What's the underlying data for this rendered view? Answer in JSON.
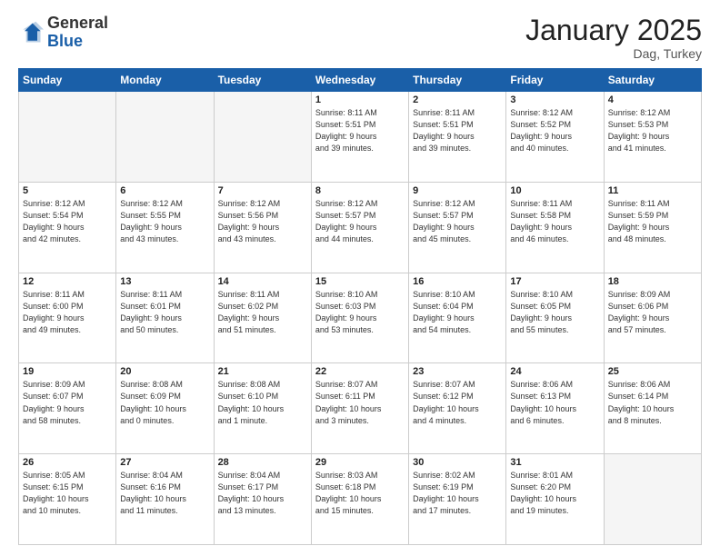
{
  "header": {
    "logo_general": "General",
    "logo_blue": "Blue",
    "month_title": "January 2025",
    "subtitle": "Dag, Turkey"
  },
  "weekdays": [
    "Sunday",
    "Monday",
    "Tuesday",
    "Wednesday",
    "Thursday",
    "Friday",
    "Saturday"
  ],
  "weeks": [
    [
      {
        "day": "",
        "info": ""
      },
      {
        "day": "",
        "info": ""
      },
      {
        "day": "",
        "info": ""
      },
      {
        "day": "1",
        "info": "Sunrise: 8:11 AM\nSunset: 5:51 PM\nDaylight: 9 hours\nand 39 minutes."
      },
      {
        "day": "2",
        "info": "Sunrise: 8:11 AM\nSunset: 5:51 PM\nDaylight: 9 hours\nand 39 minutes."
      },
      {
        "day": "3",
        "info": "Sunrise: 8:12 AM\nSunset: 5:52 PM\nDaylight: 9 hours\nand 40 minutes."
      },
      {
        "day": "4",
        "info": "Sunrise: 8:12 AM\nSunset: 5:53 PM\nDaylight: 9 hours\nand 41 minutes."
      }
    ],
    [
      {
        "day": "5",
        "info": "Sunrise: 8:12 AM\nSunset: 5:54 PM\nDaylight: 9 hours\nand 42 minutes."
      },
      {
        "day": "6",
        "info": "Sunrise: 8:12 AM\nSunset: 5:55 PM\nDaylight: 9 hours\nand 43 minutes."
      },
      {
        "day": "7",
        "info": "Sunrise: 8:12 AM\nSunset: 5:56 PM\nDaylight: 9 hours\nand 43 minutes."
      },
      {
        "day": "8",
        "info": "Sunrise: 8:12 AM\nSunset: 5:57 PM\nDaylight: 9 hours\nand 44 minutes."
      },
      {
        "day": "9",
        "info": "Sunrise: 8:12 AM\nSunset: 5:57 PM\nDaylight: 9 hours\nand 45 minutes."
      },
      {
        "day": "10",
        "info": "Sunrise: 8:11 AM\nSunset: 5:58 PM\nDaylight: 9 hours\nand 46 minutes."
      },
      {
        "day": "11",
        "info": "Sunrise: 8:11 AM\nSunset: 5:59 PM\nDaylight: 9 hours\nand 48 minutes."
      }
    ],
    [
      {
        "day": "12",
        "info": "Sunrise: 8:11 AM\nSunset: 6:00 PM\nDaylight: 9 hours\nand 49 minutes."
      },
      {
        "day": "13",
        "info": "Sunrise: 8:11 AM\nSunset: 6:01 PM\nDaylight: 9 hours\nand 50 minutes."
      },
      {
        "day": "14",
        "info": "Sunrise: 8:11 AM\nSunset: 6:02 PM\nDaylight: 9 hours\nand 51 minutes."
      },
      {
        "day": "15",
        "info": "Sunrise: 8:10 AM\nSunset: 6:03 PM\nDaylight: 9 hours\nand 53 minutes."
      },
      {
        "day": "16",
        "info": "Sunrise: 8:10 AM\nSunset: 6:04 PM\nDaylight: 9 hours\nand 54 minutes."
      },
      {
        "day": "17",
        "info": "Sunrise: 8:10 AM\nSunset: 6:05 PM\nDaylight: 9 hours\nand 55 minutes."
      },
      {
        "day": "18",
        "info": "Sunrise: 8:09 AM\nSunset: 6:06 PM\nDaylight: 9 hours\nand 57 minutes."
      }
    ],
    [
      {
        "day": "19",
        "info": "Sunrise: 8:09 AM\nSunset: 6:07 PM\nDaylight: 9 hours\nand 58 minutes."
      },
      {
        "day": "20",
        "info": "Sunrise: 8:08 AM\nSunset: 6:09 PM\nDaylight: 10 hours\nand 0 minutes."
      },
      {
        "day": "21",
        "info": "Sunrise: 8:08 AM\nSunset: 6:10 PM\nDaylight: 10 hours\nand 1 minute."
      },
      {
        "day": "22",
        "info": "Sunrise: 8:07 AM\nSunset: 6:11 PM\nDaylight: 10 hours\nand 3 minutes."
      },
      {
        "day": "23",
        "info": "Sunrise: 8:07 AM\nSunset: 6:12 PM\nDaylight: 10 hours\nand 4 minutes."
      },
      {
        "day": "24",
        "info": "Sunrise: 8:06 AM\nSunset: 6:13 PM\nDaylight: 10 hours\nand 6 minutes."
      },
      {
        "day": "25",
        "info": "Sunrise: 8:06 AM\nSunset: 6:14 PM\nDaylight: 10 hours\nand 8 minutes."
      }
    ],
    [
      {
        "day": "26",
        "info": "Sunrise: 8:05 AM\nSunset: 6:15 PM\nDaylight: 10 hours\nand 10 minutes."
      },
      {
        "day": "27",
        "info": "Sunrise: 8:04 AM\nSunset: 6:16 PM\nDaylight: 10 hours\nand 11 minutes."
      },
      {
        "day": "28",
        "info": "Sunrise: 8:04 AM\nSunset: 6:17 PM\nDaylight: 10 hours\nand 13 minutes."
      },
      {
        "day": "29",
        "info": "Sunrise: 8:03 AM\nSunset: 6:18 PM\nDaylight: 10 hours\nand 15 minutes."
      },
      {
        "day": "30",
        "info": "Sunrise: 8:02 AM\nSunset: 6:19 PM\nDaylight: 10 hours\nand 17 minutes."
      },
      {
        "day": "31",
        "info": "Sunrise: 8:01 AM\nSunset: 6:20 PM\nDaylight: 10 hours\nand 19 minutes."
      },
      {
        "day": "",
        "info": ""
      }
    ]
  ]
}
